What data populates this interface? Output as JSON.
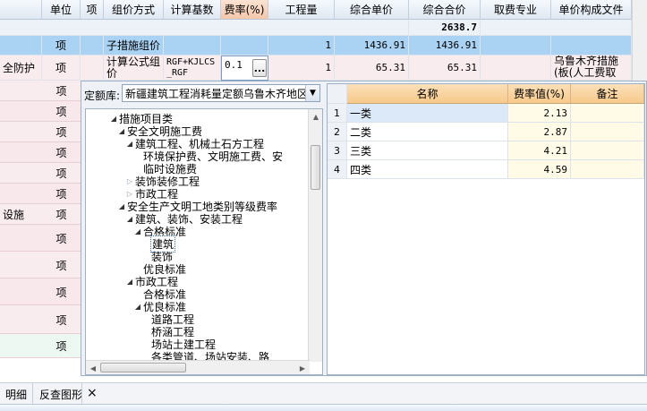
{
  "grid": {
    "headers": [
      "单位",
      "项",
      "组价方式",
      "计算基数",
      "费率(%)",
      "工程量",
      "综合单价",
      "综合合价",
      "取费专业",
      "单价构成文件"
    ],
    "total_row": {
      "amount": "2638.7"
    },
    "row1": {
      "unit": "项",
      "method": "子措施组价",
      "qty": "1",
      "price": "1436.91",
      "amount": "1436.91"
    },
    "row2": {
      "left_label": "全防护",
      "unit": "项",
      "method": "计算公式组价",
      "base": "RGF+KJLCS_RGF",
      "rate": "0.1",
      "qty": "1",
      "price": "65.31",
      "amount": "65.31",
      "file": "乌鲁木齐措施(板(人工费取"
    },
    "left_units": [
      "项",
      "项",
      "项",
      "项",
      "项",
      "项",
      "项",
      "项",
      "项",
      "项",
      "项",
      "项"
    ],
    "left_label_mid": "设施",
    "more_button": "..."
  },
  "dialog": {
    "lib_label": "定额库:",
    "lib_value": "新疆建筑工程消耗量定额乌鲁木齐地区",
    "tree": [
      {
        "label": "措施项目类",
        "depth": 0,
        "state": "open"
      },
      {
        "label": "安全文明施工费",
        "depth": 1,
        "state": "open"
      },
      {
        "label": "建筑工程、机械土石方工程",
        "depth": 2,
        "state": "open"
      },
      {
        "label": "环境保护费、文明施工费、安",
        "depth": 3,
        "state": "leaf"
      },
      {
        "label": "临时设施费",
        "depth": 3,
        "state": "leaf"
      },
      {
        "label": "装饰装修工程",
        "depth": 2,
        "state": "closed"
      },
      {
        "label": "市政工程",
        "depth": 2,
        "state": "closed"
      },
      {
        "label": "安全生产文明工地类别等级费率",
        "depth": 1,
        "state": "open"
      },
      {
        "label": "建筑、装饰、安装工程",
        "depth": 2,
        "state": "open"
      },
      {
        "label": "合格标准",
        "depth": 3,
        "state": "open"
      },
      {
        "label": "建筑",
        "depth": 4,
        "state": "leaf",
        "selected": true
      },
      {
        "label": "装饰",
        "depth": 4,
        "state": "leaf"
      },
      {
        "label": "优良标准",
        "depth": 3,
        "state": "leaf"
      },
      {
        "label": "市政工程",
        "depth": 2,
        "state": "open"
      },
      {
        "label": "合格标准",
        "depth": 3,
        "state": "leaf"
      },
      {
        "label": "优良标准",
        "depth": 3,
        "state": "open"
      },
      {
        "label": "道路工程",
        "depth": 4,
        "state": "leaf"
      },
      {
        "label": "桥涵工程",
        "depth": 4,
        "state": "leaf"
      },
      {
        "label": "场站土建工程",
        "depth": 4,
        "state": "leaf"
      },
      {
        "label": "各类管道、场站安装、路",
        "depth": 4,
        "state": "leaf"
      }
    ],
    "rate_table": {
      "headers": [
        "名称",
        "费率值(%)",
        "备注"
      ],
      "rows": [
        {
          "idx": "1",
          "name": "一类",
          "value": "2.13",
          "note": ""
        },
        {
          "idx": "2",
          "name": "二类",
          "value": "2.87",
          "note": ""
        },
        {
          "idx": "3",
          "name": "三类",
          "value": "4.21",
          "note": ""
        },
        {
          "idx": "4",
          "name": "四类",
          "value": "4.59",
          "note": ""
        }
      ]
    }
  },
  "bottom": {
    "tabs": [
      "明细",
      "反查图形"
    ],
    "close": "×"
  },
  "colors": {
    "selected_row": "#a9d2f3",
    "rate_header": "#f7c98a",
    "pink_rows": "#f9ecef"
  }
}
